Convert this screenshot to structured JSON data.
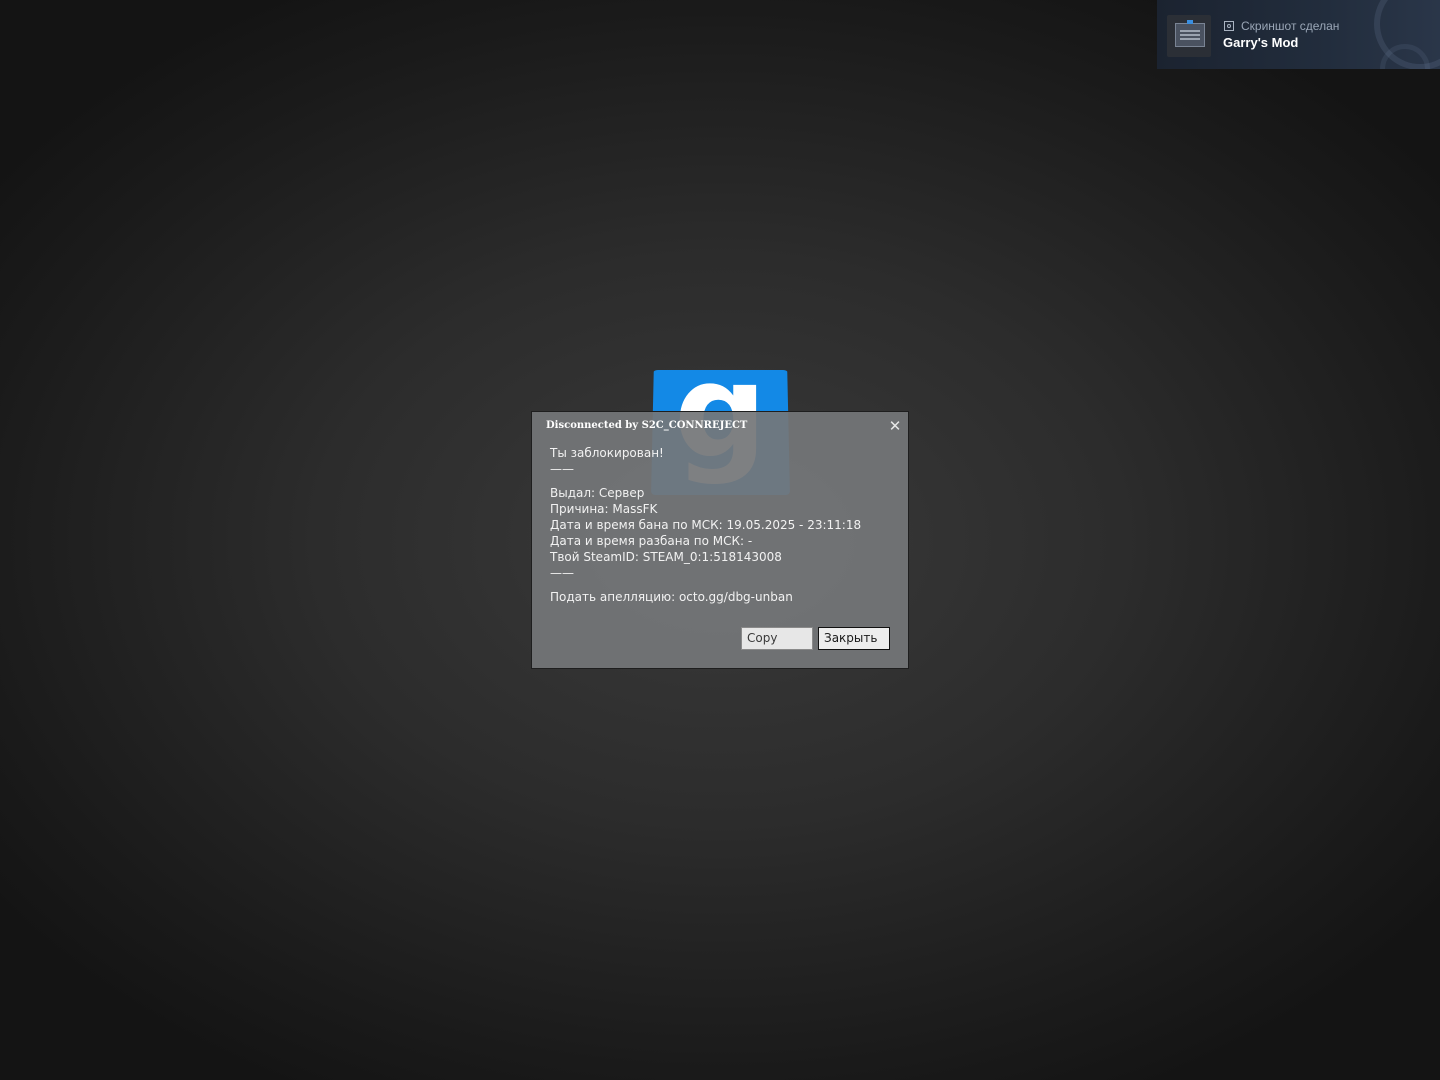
{
  "background": {
    "color": "#2c2c2c"
  },
  "logo": {
    "icon": "gmod-logo-icon",
    "letter": "g",
    "color": "#1389e6"
  },
  "toast": {
    "subtitle": "Скриншот сделан",
    "title": "Garry's Mod",
    "icon": "camera-icon"
  },
  "dialog": {
    "title": "Disconnected by S2C_CONNREJECT",
    "close_glyph": "✕",
    "message": {
      "heading": "Ты заблокирован!",
      "separator": "——",
      "lines": [
        "Выдал: Сервер",
        "Причина: MassFK",
        "Дата и время бана по МСК: 19.05.2025 - 23:11:18",
        "Дата и время разбана по МСК: -",
        "Твой SteamID: STEAM_0:1:518143008"
      ],
      "appeal": "Подать апелляцию: octo.gg/dbg-unban"
    },
    "buttons": {
      "copy_label": "Copy",
      "close_label": "Закрыть"
    }
  }
}
